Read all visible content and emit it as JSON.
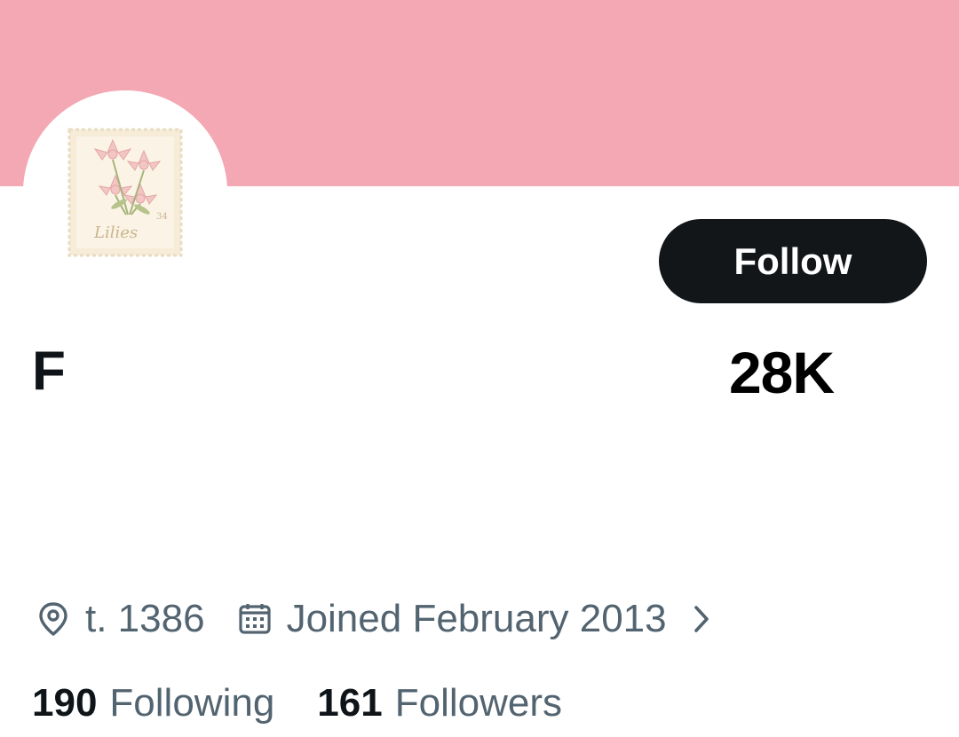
{
  "profile": {
    "display_name": "F",
    "location": "t. 1386",
    "joined": "Joined February 2013",
    "overlay_stat": "28K",
    "avatar": {
      "stamp_text": "Lilies",
      "stamp_value": "34"
    }
  },
  "actions": {
    "follow_label": "Follow"
  },
  "counts": {
    "following_num": "190",
    "following_label": "Following",
    "followers_num": "161",
    "followers_label": "Followers"
  },
  "colors": {
    "banner": "#f3a8b3",
    "follow_bg": "#121619",
    "secondary_text": "#536471"
  },
  "icons": {
    "location": "location-pin-icon",
    "calendar": "calendar-icon",
    "chevron": "chevron-right-icon"
  }
}
